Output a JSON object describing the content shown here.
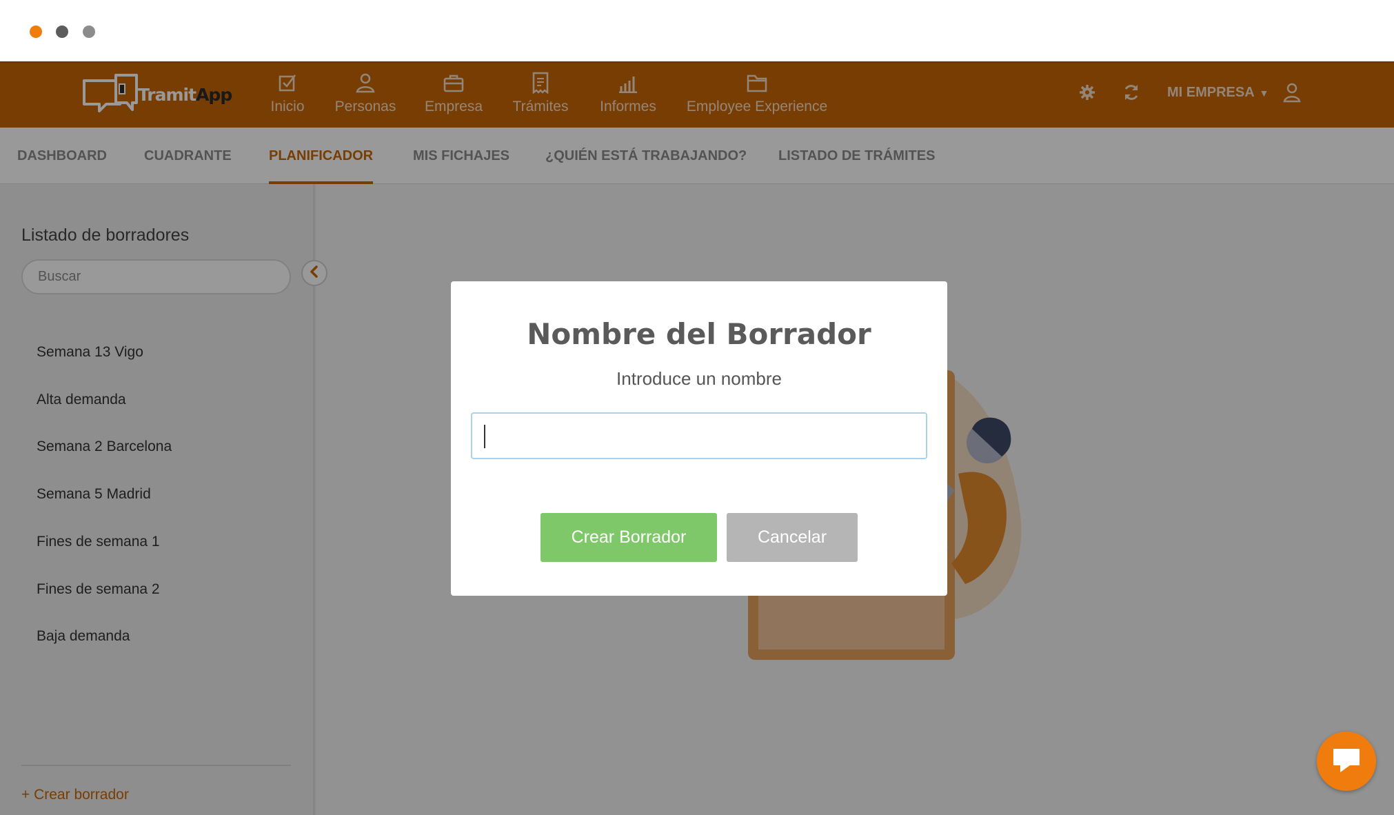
{
  "window": {
    "dots": [
      "close",
      "minimize",
      "maximize"
    ]
  },
  "brand": {
    "logo_text_a": "Tramit",
    "logo_text_b": "App"
  },
  "topnav": {
    "items": [
      {
        "label": "Inicio",
        "icon": "checkbox-icon"
      },
      {
        "label": "Personas",
        "icon": "person-icon"
      },
      {
        "label": "Empresa",
        "icon": "briefcase-icon"
      },
      {
        "label": "Trámites",
        "icon": "receipt-icon"
      },
      {
        "label": "Informes",
        "icon": "bar-chart-icon"
      },
      {
        "label": "Employee Experience",
        "icon": "folder-icon"
      }
    ],
    "company": "MI EMPRESA",
    "tools": [
      "gear-icon",
      "refresh-icon",
      "user-icon"
    ]
  },
  "subnav": {
    "tabs": [
      {
        "label": "DASHBOARD"
      },
      {
        "label": "CUADRANTE"
      },
      {
        "label": "PLANIFICADOR",
        "active": true
      },
      {
        "label": "MIS FICHAJES"
      },
      {
        "label": "¿QUIÉN ESTÁ TRABAJANDO?"
      },
      {
        "label": "LISTADO DE TRÁMITES"
      }
    ]
  },
  "sidebar": {
    "title": "Listado de borradores",
    "search_placeholder": "Buscar",
    "items": [
      "Semana 13 Vigo",
      "Alta demanda",
      "Semana 2 Barcelona",
      "Semana 5 Madrid",
      "Fines de semana 1",
      "Fines de semana 2",
      "Baja demanda"
    ],
    "create_label": "+ Crear borrador"
  },
  "modal": {
    "title": "Nombre del Borrador",
    "subtitle": "Introduce un nombre",
    "input_value": "",
    "create_button": "Crear Borrador",
    "cancel_button": "Cancelar"
  },
  "colors": {
    "brand_orange": "#c86604",
    "accent_orange": "#f07c0e",
    "create_green": "#7ec869",
    "cancel_gray": "#b5b5b5"
  }
}
